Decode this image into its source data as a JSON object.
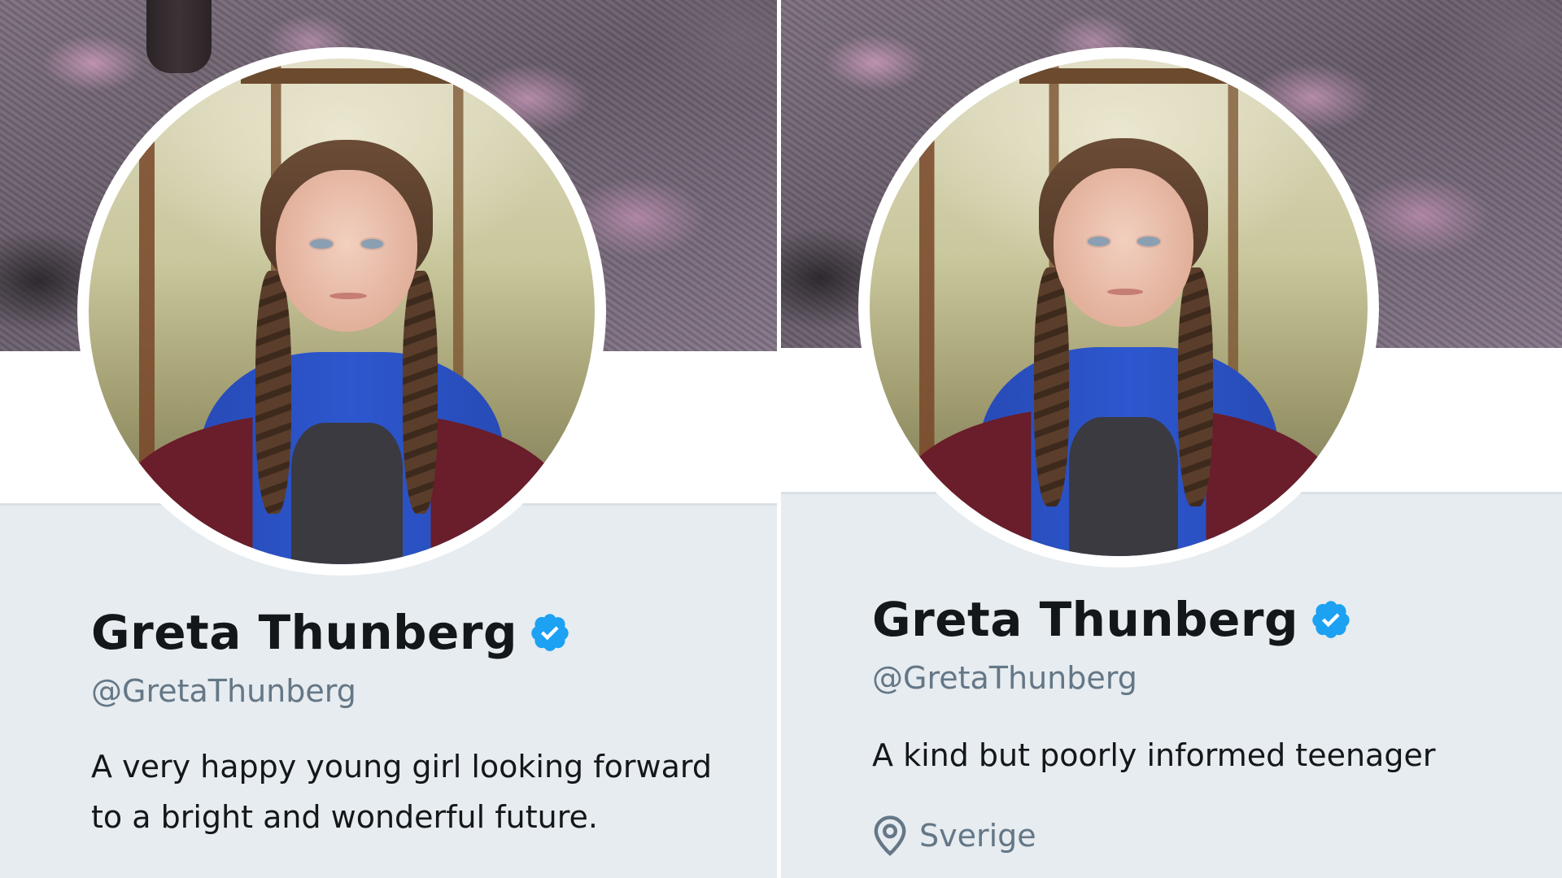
{
  "panels": [
    {
      "display_name": "Greta Thunberg",
      "handle": "@GretaThunberg",
      "bio_lines": [
        "A very happy young girl looking forward",
        "to a bright and wonderful future."
      ],
      "location": null
    },
    {
      "display_name": "Greta Thunberg",
      "handle": "@GretaThunberg",
      "bio_lines": [
        "A kind but poorly informed teenager"
      ],
      "location": "Sverige"
    }
  ],
  "icons": {
    "verified": "verified-badge-icon",
    "location": "location-pin-icon"
  },
  "colors": {
    "verified_blue": "#1da1f2",
    "background": "#e6ecf0",
    "name": "#14171a",
    "secondary_text": "#657786"
  }
}
